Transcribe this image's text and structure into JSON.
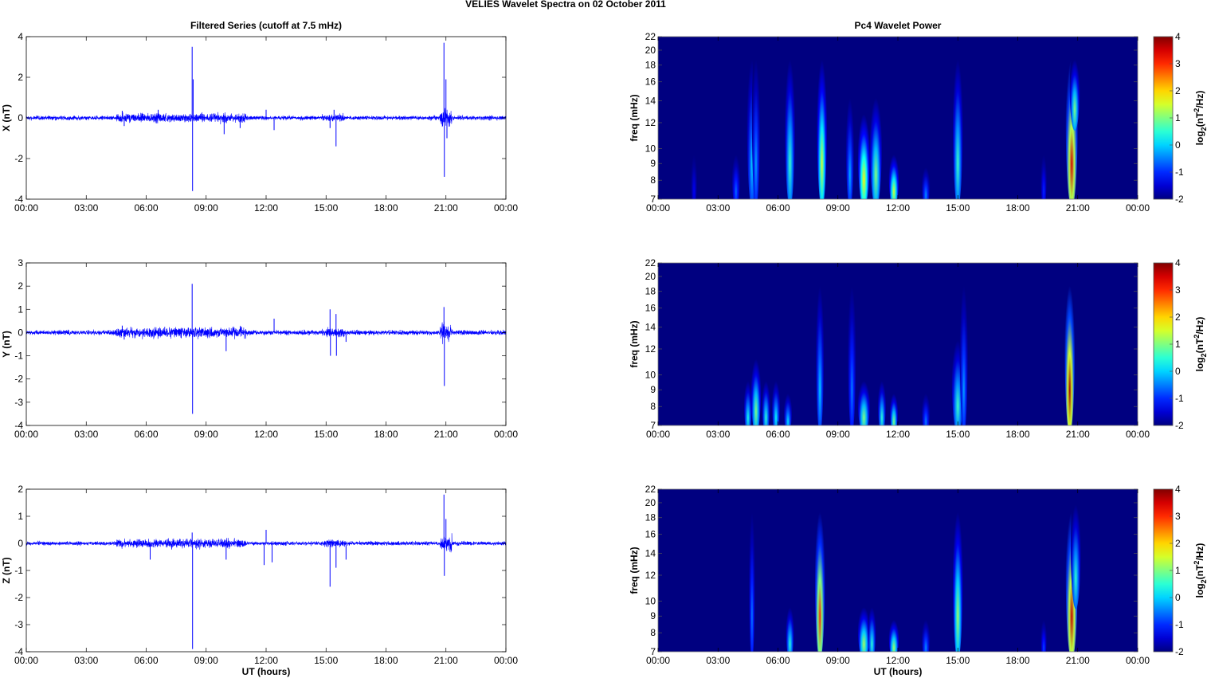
{
  "chart_data": {
    "type": "line+heatmap",
    "title": "VELIES Wavelet Spectra on 02 October   2011",
    "left_title": "Filtered Series (cutoff at 7.5 mHz)",
    "right_title": "Pc4 Wavelet Power",
    "xlabel": "UT (hours)",
    "x_ticks": [
      "00:00",
      "03:00",
      "06:00",
      "09:00",
      "12:00",
      "15:00",
      "18:00",
      "21:00",
      "00:00"
    ],
    "xlim_hours": [
      0,
      24
    ],
    "freq_label": "freq (mHz)",
    "freq_ticks": [
      7,
      8,
      9,
      10,
      12,
      14,
      16,
      18,
      20,
      22
    ],
    "freq_range_mhz": [
      7,
      22
    ],
    "colorbar": {
      "label_main": "log",
      "label_sub": "2",
      "label_rest": "(nT",
      "label_sup": "2",
      "label_end": "/Hz)",
      "ticks": [
        -2,
        -1,
        0,
        1,
        2,
        3,
        4
      ],
      "range": [
        -2,
        4
      ],
      "colormap": "jet"
    },
    "series_color": "#0000ff",
    "panels": [
      {
        "ylabel": "X (nT)",
        "ylim": [
          -4,
          4
        ],
        "yticks": [
          -4,
          -2,
          0,
          2,
          4
        ],
        "noise": 0.07,
        "spikes": [
          [
            8.3,
            3.5
          ],
          [
            8.32,
            -3.6
          ],
          [
            8.35,
            1.9
          ],
          [
            20.9,
            3.7
          ],
          [
            20.92,
            -2.9
          ],
          [
            21.0,
            1.9
          ],
          [
            21.05,
            -1.0
          ],
          [
            15.5,
            -1.4
          ],
          [
            15.2,
            -0.5
          ],
          [
            4.9,
            -0.4
          ],
          [
            4.8,
            0.35
          ],
          [
            6.6,
            0.4
          ],
          [
            9.9,
            -0.8
          ],
          [
            10.7,
            -0.5
          ],
          [
            12.4,
            -0.6
          ],
          [
            12.0,
            0.4
          ],
          [
            15.4,
            0.4
          ]
        ],
        "wavelet": [
          [
            1.8,
            7,
            10,
            -1.3,
            0.15
          ],
          [
            3.9,
            7,
            10,
            -0.6,
            0.2
          ],
          [
            4.7,
            7,
            22,
            0.0,
            0.25
          ],
          [
            4.9,
            7,
            22,
            -0.3,
            0.2
          ],
          [
            6.6,
            7,
            22,
            0.6,
            0.25
          ],
          [
            8.2,
            7,
            22,
            1.5,
            0.25
          ],
          [
            9.6,
            7,
            16,
            -0.2,
            0.2
          ],
          [
            10.3,
            7,
            14,
            1.8,
            0.3
          ],
          [
            10.9,
            7,
            16,
            1.0,
            0.3
          ],
          [
            11.8,
            7,
            10,
            1.5,
            0.25
          ],
          [
            13.4,
            7,
            9,
            -0.4,
            0.2
          ],
          [
            15.0,
            7,
            22,
            0.6,
            0.25
          ],
          [
            19.3,
            7,
            10,
            -1.0,
            0.15
          ],
          [
            20.7,
            7,
            22,
            3.5,
            0.3
          ],
          [
            20.85,
            12,
            20,
            1.0,
            0.25
          ]
        ]
      },
      {
        "ylabel": "Y (nT)",
        "ylim": [
          -4,
          3
        ],
        "yticks": [
          -4,
          -3,
          -2,
          -1,
          0,
          1,
          2,
          3
        ],
        "noise": 0.07,
        "spikes": [
          [
            8.3,
            2.1
          ],
          [
            8.32,
            -3.5
          ],
          [
            20.9,
            1.1
          ],
          [
            20.92,
            -2.3
          ],
          [
            15.2,
            1.0
          ],
          [
            15.22,
            -1.0
          ],
          [
            15.5,
            0.8
          ],
          [
            15.52,
            -1.0
          ],
          [
            10.0,
            -0.8
          ],
          [
            4.8,
            0.3
          ],
          [
            4.9,
            -0.3
          ],
          [
            12.4,
            0.6
          ],
          [
            16.0,
            -0.4
          ]
        ],
        "wavelet": [
          [
            4.5,
            7,
            10,
            0.4,
            0.2
          ],
          [
            4.9,
            7,
            12,
            1.0,
            0.25
          ],
          [
            5.4,
            7,
            10,
            0.5,
            0.2
          ],
          [
            5.9,
            7,
            10,
            0.3,
            0.2
          ],
          [
            6.5,
            7,
            9,
            0.1,
            0.2
          ],
          [
            8.1,
            7,
            22,
            0.0,
            0.2
          ],
          [
            9.7,
            7,
            22,
            -0.5,
            0.2
          ],
          [
            10.3,
            7,
            10,
            1.0,
            0.3
          ],
          [
            11.2,
            7,
            10,
            0.5,
            0.2
          ],
          [
            11.8,
            7,
            9,
            1.0,
            0.2
          ],
          [
            13.4,
            7,
            9,
            -0.5,
            0.2
          ],
          [
            15.0,
            7,
            14,
            0.6,
            0.3
          ],
          [
            15.3,
            7,
            22,
            -0.3,
            0.2
          ],
          [
            20.6,
            7,
            22,
            3.8,
            0.25
          ]
        ]
      },
      {
        "ylabel": "Z (nT)",
        "ylim": [
          -4,
          2
        ],
        "yticks": [
          -4,
          -3,
          -2,
          -1,
          0,
          1,
          2
        ],
        "noise": 0.05,
        "spikes": [
          [
            8.3,
            0.4
          ],
          [
            8.32,
            -3.9
          ],
          [
            20.9,
            1.8
          ],
          [
            20.92,
            -1.2
          ],
          [
            21.0,
            0.9
          ],
          [
            15.2,
            -1.6
          ],
          [
            11.9,
            -0.8
          ],
          [
            12.3,
            -0.7
          ],
          [
            16.0,
            -0.6
          ],
          [
            10.0,
            -0.6
          ],
          [
            6.2,
            -0.6
          ],
          [
            15.5,
            -0.9
          ],
          [
            12.0,
            0.5
          ]
        ],
        "wavelet": [
          [
            4.7,
            7,
            22,
            -0.5,
            0.15
          ],
          [
            6.6,
            7,
            10,
            0.5,
            0.2
          ],
          [
            8.1,
            7,
            22,
            3.0,
            0.25
          ],
          [
            10.3,
            7,
            10,
            1.2,
            0.3
          ],
          [
            10.7,
            7,
            10,
            0.5,
            0.2
          ],
          [
            11.8,
            7,
            9,
            1.2,
            0.25
          ],
          [
            13.4,
            7,
            9,
            -0.4,
            0.2
          ],
          [
            15.0,
            7,
            22,
            1.2,
            0.25
          ],
          [
            19.3,
            7,
            9,
            -0.8,
            0.15
          ],
          [
            20.7,
            7,
            22,
            3.6,
            0.3
          ],
          [
            20.9,
            10,
            22,
            0.5,
            0.25
          ]
        ]
      }
    ]
  }
}
